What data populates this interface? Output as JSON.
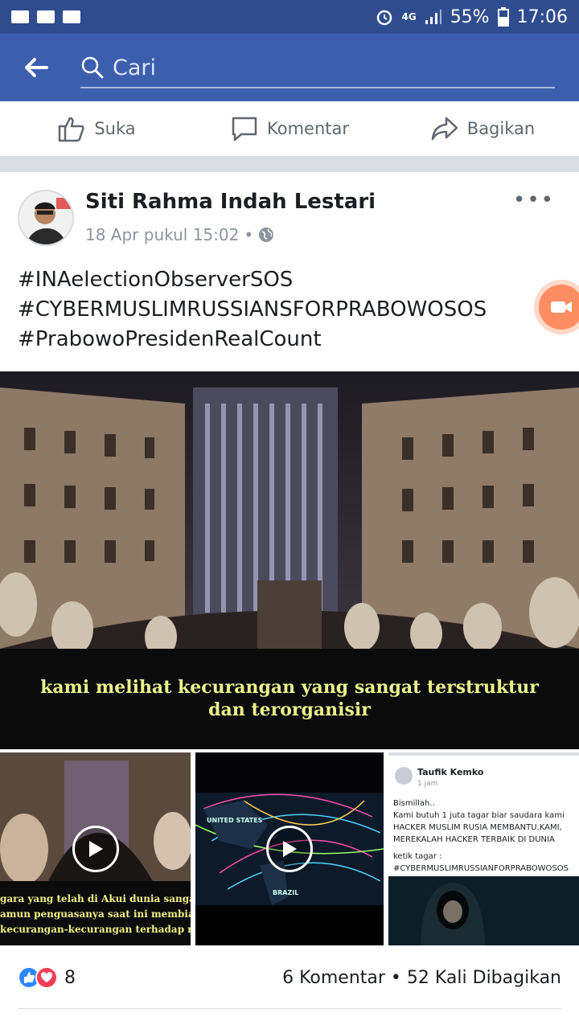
{
  "status_bar": {
    "network": "4G",
    "battery": "55%",
    "time": "17:06",
    "icons": [
      "gmail-icon",
      "video-camera-icon",
      "pulse-app-icon",
      "alarm-icon",
      "signal-icon",
      "battery-icon"
    ]
  },
  "appbar": {
    "back_icon": "back-arrow-icon",
    "search_icon": "search-icon",
    "search_placeholder": "Cari"
  },
  "top_actions": [
    {
      "label": "Suka",
      "icon": "thumbs-up-icon"
    },
    {
      "label": "Komentar",
      "icon": "comment-icon"
    },
    {
      "label": "Bagikan",
      "icon": "share-icon"
    }
  ],
  "post": {
    "author": "Siti Rahma Indah Lestari",
    "timestamp": "18 Apr pukul 15:02",
    "separator": "•",
    "privacy_icon": "globe-icon",
    "more_label": "•••",
    "text_lines": [
      "#INAelectionObserverSOS",
      "#CYBERMUSLIMRUSSIANSFORPRABOWOSOS",
      "#PrabowoPresidenRealCount"
    ],
    "main_media": {
      "caption_line1": "kami melihat kecurangan yang sangat terstruktur",
      "caption_line2": "dan terorganisir"
    },
    "thumbnails": [
      {
        "type": "video",
        "caption_line1": "gara yang telah di Akui dunia sangat Ka",
        "caption_line2": "amun penguasanya saat ini membiarka",
        "caption_line3": "kecurangan-kecurangan terhadap rakya"
      },
      {
        "type": "video",
        "map_label_1": "UNITED STATES",
        "map_label_2": "BRAZIL"
      },
      {
        "type": "image",
        "name": "Taufik Kemko",
        "time": "1 jam",
        "line1": "Bismillah..",
        "line2": "Kami butuh 1 juta tagar biar saudara kami",
        "line3": "HACKER MUSLIM RUSIA MEMBANTU.KAMI,",
        "line4": "MEREKALAH HACKER TERBAIK DI DUNIA",
        "line5": "ketik tagar :",
        "line6": "#CYBERMUSLIMRUSSIANFORPRABOWOSOS"
      }
    ],
    "reactions_count": "8",
    "comments": "6 Komentar",
    "shares": "52 Kali Dibagikan",
    "dot": "•"
  },
  "colors": {
    "status_bar": "#2f4c8f",
    "app_bar": "#3b5fae",
    "like": "#2d88ff",
    "love": "#f33e58",
    "subtitle": "#e9f28c"
  }
}
